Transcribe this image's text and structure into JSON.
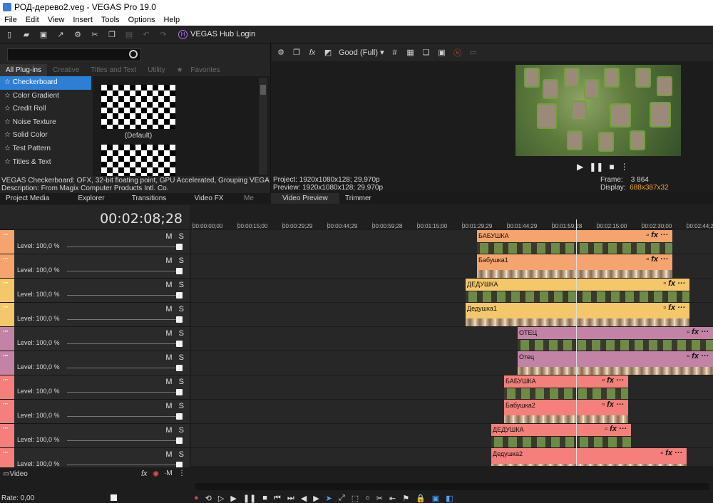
{
  "window": {
    "title": "РОД-дерево2.veg - VEGAS Pro 19.0"
  },
  "menu": [
    "File",
    "Edit",
    "View",
    "Insert",
    "Tools",
    "Options",
    "Help"
  ],
  "toolbar": {
    "hub_label": "VEGAS Hub Login",
    "hub_glyph": "H"
  },
  "plugins": {
    "tabs": [
      "All Plug-ins",
      "Creative",
      "Titles and Text",
      "Utility",
      "Favorites"
    ],
    "items": [
      "Checkerboard",
      "Color Gradient",
      "Credit Roll",
      "Noise Texture",
      "Solid Color",
      "Test Pattern",
      "Titles & Text"
    ],
    "selected_index": 0,
    "preset_label": "(Default)",
    "description_line1": "VEGAS Checkerboard: OFX, 32-bit floating point, GPU Accelerated, Grouping VEGAS, Ver",
    "description_line2": "Description: From Magix Computer Products Intl. Co."
  },
  "preview": {
    "quality": "Good (Full)",
    "project": "Project:   1920x1080x128; 29,970p",
    "preview_line": "Preview:  1920x1080x128; 29,970p",
    "frame_label": "Frame:",
    "frame_value": "3 864",
    "display_label": "Display:",
    "display_value": "688x387x32"
  },
  "window_tabs": [
    "Project Media",
    "Explorer",
    "Transitions",
    "Video FX",
    "Me",
    "Video Preview",
    "Trimmer"
  ],
  "timeline": {
    "timecode": "00:02:08;28",
    "ruler": [
      "00:00:00;00",
      "00:00:15;00",
      "00:00:29;29",
      "00:00:44;29",
      "00:00:59;28",
      "00:01:15;00",
      "00:01:29;29",
      "00:01:44;29",
      "00:01:59;28",
      "00:02:15;00",
      "00:02:30;00",
      "00:02:44;29"
    ],
    "tracks": [
      {
        "color": "#f5a46e",
        "level": "Level: 100,0 %"
      },
      {
        "color": "#f5a46e",
        "level": "Level: 100,0 %"
      },
      {
        "color": "#f5c76b",
        "level": "Level: 100,0 %"
      },
      {
        "color": "#f5c76b",
        "level": "Level: 100,0 %"
      },
      {
        "color": "#c283a6",
        "level": "Level: 100,0 %"
      },
      {
        "color": "#c283a6",
        "level": "Level: 100,0 %"
      },
      {
        "color": "#f57f7a",
        "level": "Level: 100,0 %"
      },
      {
        "color": "#f57f7a",
        "level": "Level: 100,0 %"
      },
      {
        "color": "#f57f7a",
        "level": "Level: 100,0 %"
      },
      {
        "color": "#f57f7a",
        "level": "Level: 100,0 %"
      }
    ],
    "clips": [
      {
        "label": "БАБУШКА",
        "color": "#f5a46e",
        "kind": "film"
      },
      {
        "label": "Бабушка1",
        "color": "#f5a46e",
        "kind": "faces"
      },
      {
        "label": "ДЕДУШКА",
        "color": "#f5c76b",
        "kind": "film"
      },
      {
        "label": "Дедушка1",
        "color": "#f5c76b",
        "kind": "faces"
      },
      {
        "label": "ОТЕЦ",
        "color": "#c283a6",
        "kind": "film"
      },
      {
        "label": "Отец",
        "color": "#c283a6",
        "kind": "faces"
      },
      {
        "label": "БАБУШКА",
        "color": "#f57f7a",
        "kind": "film"
      },
      {
        "label": "Бабушка2",
        "color": "#f57f7a",
        "kind": "faces"
      },
      {
        "label": "ДЕДУШКА",
        "color": "#f57f7a",
        "kind": "film"
      },
      {
        "label": "Дедушка2",
        "color": "#f57f7a",
        "kind": "faces"
      }
    ],
    "mute_label": "M",
    "solo_label": "S"
  },
  "bottom": {
    "bus_label": "Video",
    "rate": "Rate: 0,00"
  }
}
